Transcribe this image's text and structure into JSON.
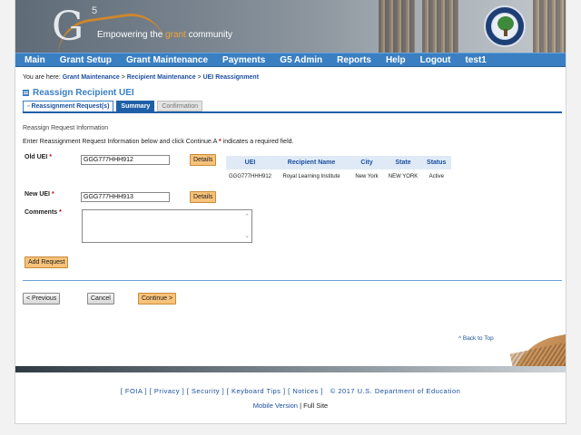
{
  "banner": {
    "logo_text": "G",
    "logo_sup": "5",
    "tagline_before": "Empowering the ",
    "tagline_highlight": "grant",
    "tagline_after": " community"
  },
  "nav": {
    "items": [
      "Main",
      "Grant Setup",
      "Grant Maintenance",
      "Payments",
      "G5 Admin",
      "Reports",
      "Help",
      "Logout",
      "test1"
    ]
  },
  "breadcrumb": {
    "prefix": "You are here: ",
    "items": [
      "Grant Maintenance",
      "Recipient Maintenance",
      "UEI Reassignment"
    ],
    "separator": " > "
  },
  "page_title": "Reassign Recipient UEI",
  "tabs": [
    "Reassignment Request(s)",
    "Summary",
    "Confirmation"
  ],
  "section_heading": "Reassign Request Information",
  "instructions": {
    "text": "Enter Reassignment Request Information below and click Continue.A ",
    "asterisk": "*",
    "suffix": " indicates a required field."
  },
  "form": {
    "old_uei_label": "Old UEI",
    "old_uei_value": "GGG777HHH912",
    "new_uei_label": "New UEI",
    "new_uei_value": "GGG777HHH913",
    "comments_label": "Comments",
    "required_mark": "*",
    "details_label": "Details",
    "add_request_label": "Add Request"
  },
  "table": {
    "headers": [
      "UEI",
      "Recipient Name",
      "City",
      "State",
      "Status"
    ],
    "rows": [
      [
        "GGG777HHH912",
        "Royal Learning Institute",
        "New York",
        "NEW YORK",
        "Active"
      ]
    ]
  },
  "actions": {
    "previous": "< Previous",
    "cancel": "Cancel",
    "continue": "Continue >"
  },
  "back_to_top": "^ Back to Top",
  "footer": {
    "links": [
      "[ FOIA ]",
      "[ Privacy ]",
      "[ Security ]",
      "[ Keyboard Tips ]",
      "[ Notices ]"
    ],
    "copyright": "© 2017 U.S. Department of Education",
    "mobile": "Mobile Version",
    "separator": " | ",
    "full_site": "Full Site"
  },
  "colors": {
    "nav_blue": "#3a7fc2",
    "tab_blue": "#1f5fa8",
    "button_orange": "#f7c27a",
    "required_red": "#cc0000"
  }
}
